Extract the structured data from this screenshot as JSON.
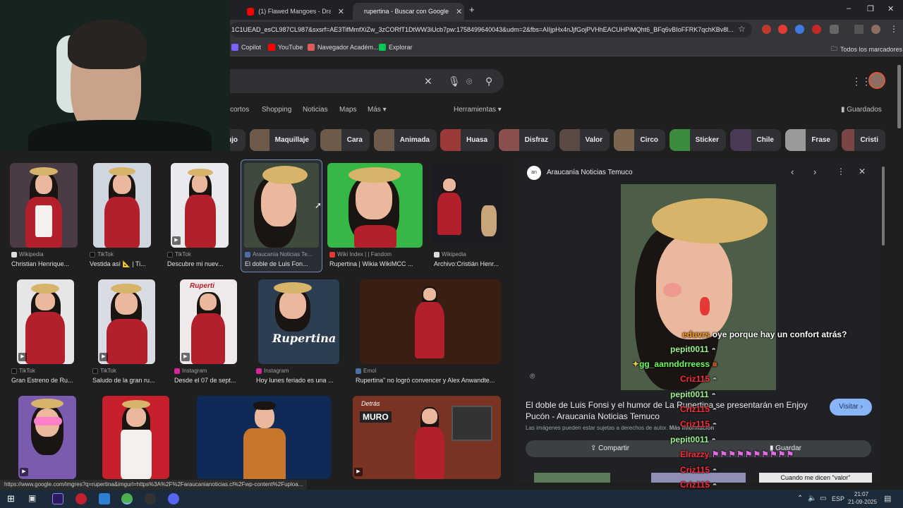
{
  "browser": {
    "tabs": [
      {
        "label": "(1) Flawed Mangoes - Dramam",
        "color": "#ff0000"
      },
      {
        "label": "rupertina - Buscar con Google",
        "color": "#4285f4"
      }
    ],
    "address": "1C1UEAD_esCL987CL987&sxsrf=AE3TifMmfXiZw_3zCORfT1DtWW3iUcb7pw:1758499640043&udm=2&fbs=AIIjpHx4nJjfGojPVHhEACUHPiMQht6_BFq6vBIoFFRK7qchKBv8l...",
    "new_tab": "+",
    "window": {
      "minimize": "–",
      "restore": "❐",
      "close": "✕"
    }
  },
  "bookmarks": {
    "items": [
      {
        "label": "Copilot",
        "color": "#7b61ff"
      },
      {
        "label": "YouTube",
        "color": "#ff0000"
      },
      {
        "label": "Navegador Académ...",
        "color": "#e05a5a"
      },
      {
        "label": "Explorar",
        "color": "#00c853"
      }
    ],
    "all_label": "Todos los marcadores"
  },
  "search": {
    "clear": "✕",
    "tabs": [
      "cortos",
      "Shopping",
      "Noticias",
      "Maps",
      "Más ▾"
    ],
    "tools": "Herramientas ▾",
    "saved": "Guardados"
  },
  "chips": [
    "ujo",
    "Maquillaje",
    "Cara",
    "Animada",
    "Huasa",
    "Disfraz",
    "Valor",
    "Circo",
    "Sticker",
    "Chile",
    "Frase",
    "Cristi"
  ],
  "results": {
    "row1": [
      {
        "source": "Wikipedia",
        "caption": "Christian Henrique..."
      },
      {
        "source": "TikTok",
        "caption": "Vestida así 📐 | Ti..."
      },
      {
        "source": "TikTok",
        "caption": "Descubre mi nuev..."
      },
      {
        "source": "Araucanía Noticias Te...",
        "caption": "El doble de Luis Fon..."
      },
      {
        "source": "Wiki Index | | Fandom",
        "caption": "Rupertina | Wikia WikiMCC ..."
      },
      {
        "source": "Wikipedia",
        "caption": "Archivo:Cristián Henr..."
      }
    ],
    "row2": [
      {
        "source": "TikTok",
        "caption": "Gran Estreno de Ru..."
      },
      {
        "source": "TikTok",
        "caption": "Saludo de la gran ru..."
      },
      {
        "source": "Instagram",
        "caption": "Desde el 07 de sept..."
      },
      {
        "source": "Instagram",
        "caption": "Hoy lunes feriado es una ..."
      },
      {
        "source": "Emol",
        "caption": "Rupertina\" no logró convencer y Alex Anwandte..."
      }
    ],
    "overlay_texts": {
      "ruperti": "Ruperti",
      "rupertina": "Rupertina",
      "detras": "Detrás",
      "muro": "MURO"
    }
  },
  "panel": {
    "source": "Araucanía Noticias Temuco",
    "title": "El doble de Luis Fonsi y el humor de La Rupertina se presentarán en Enjoy Pucón - Araucanía Noticias Temuco",
    "visit": "Visitar",
    "copyright": "Las imágenes pueden estar sujetas a derechos de autor.",
    "more_info": "Más información",
    "share": "Compartir",
    "save": "Guardar",
    "meme_text": "Cuando me dicen \"valor\""
  },
  "chat": [
    {
      "user": "eduvrs",
      "text": "oye porque hay un confort atrás?",
      "color": "#ff9f1a"
    },
    {
      "user": "pepit0011",
      "text": "",
      "color": "#9ef58f"
    },
    {
      "user": "gg_aannddrreess",
      "text": "",
      "color": "#6bff5a"
    },
    {
      "user": "Criz115",
      "text": "",
      "color": "#ff2e3b"
    },
    {
      "user": "pepit0011",
      "text": "",
      "color": "#9ef58f"
    },
    {
      "user": "Criz115",
      "text": "",
      "color": "#ff2e3b"
    },
    {
      "user": "Criz115",
      "text": "",
      "color": "#ff2e3b"
    },
    {
      "user": "pepit0011",
      "text": "",
      "color": "#9ef58f"
    },
    {
      "user": "Elrazzy",
      "text": "",
      "color": "#ff2e3b"
    },
    {
      "user": "Criz115",
      "text": "",
      "color": "#ff2e3b"
    },
    {
      "user": "Criz115",
      "text": "",
      "color": "#ff2e3b"
    },
    {
      "user": "pepit0011",
      "text": "",
      "color": "#9ef58f"
    }
  ],
  "statusbar": {
    "url": "https://www.google.com/imgres?q=rupertina&imgurl=https%3A%2F%2Faraucanianoticias.cl%2Fwp-content%2Fuploa..."
  },
  "taskbar": {
    "lang": "ESP",
    "time": "21:07",
    "date": "21-09-2025"
  }
}
